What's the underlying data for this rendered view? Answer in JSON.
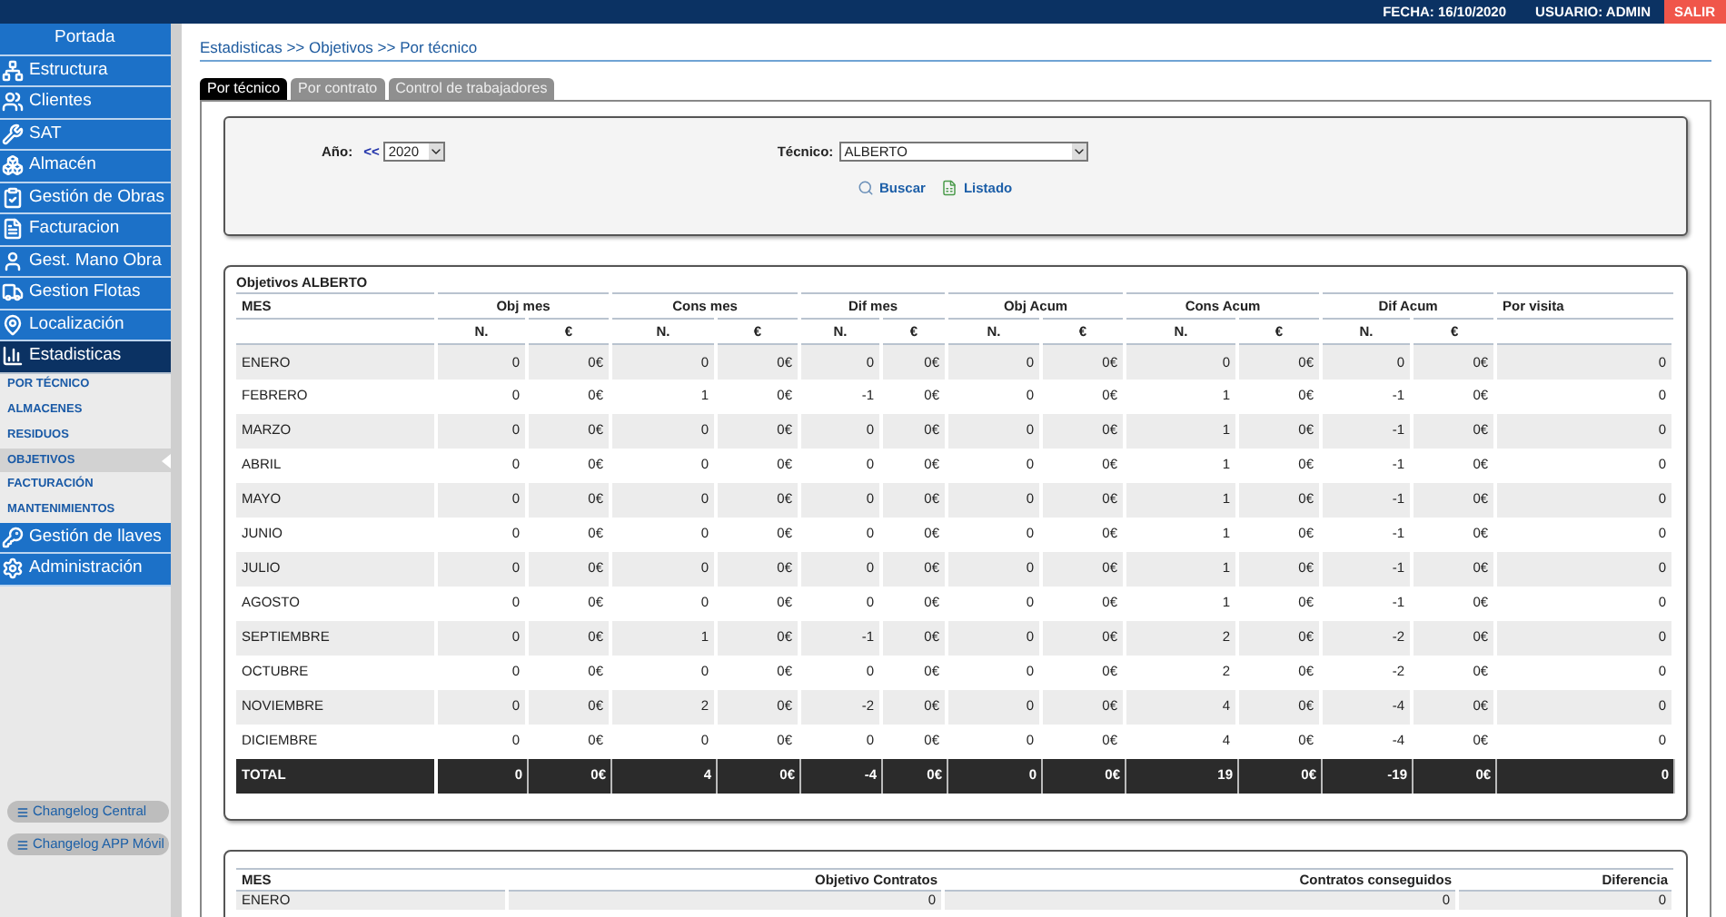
{
  "header": {
    "date": "FECHA: 16/10/2020",
    "user": "USUARIO: ADMIN",
    "logout": "SALIR"
  },
  "sidebar": {
    "items": [
      {
        "label": "Portada",
        "selected": false
      },
      {
        "label": "Estructura",
        "selected": false
      },
      {
        "label": "Clientes",
        "selected": false
      },
      {
        "label": "SAT",
        "selected": false
      },
      {
        "label": "Almacén",
        "selected": false
      },
      {
        "label": "Gestión de Obras",
        "selected": false
      },
      {
        "label": "Facturacion",
        "selected": false
      },
      {
        "label": "Gest. Mano Obra",
        "selected": false
      },
      {
        "label": "Gestion Flotas",
        "selected": false
      },
      {
        "label": "Localización",
        "selected": false
      },
      {
        "label": "Estadisticas",
        "selected": true,
        "children": [
          {
            "label": "POR TÉCNICO",
            "selected": false
          },
          {
            "label": "ALMACENES",
            "selected": false
          },
          {
            "label": "RESIDUOS",
            "selected": false
          },
          {
            "label": "OBJETIVOS",
            "selected": true
          },
          {
            "label": "FACTURACIÓN",
            "selected": false
          },
          {
            "label": "MANTENIMIENTOS",
            "selected": false
          }
        ]
      },
      {
        "label": "Gestión de llaves",
        "selected": false
      },
      {
        "label": "Administración",
        "selected": false
      }
    ],
    "changelog_buttons": [
      "Changelog Central",
      "Changelog APP Móvil"
    ]
  },
  "breadcrumb": "Estadisticas >> Objetivos >> Por técnico",
  "tabs": [
    {
      "label": "Por técnico",
      "selected": true
    },
    {
      "label": "Por contrato",
      "selected": false
    },
    {
      "label": "Control de trabajadores",
      "selected": false
    }
  ],
  "filters": {
    "year_label": "Año:",
    "prev": "<<",
    "year": "2020",
    "tech_label": "Técnico:",
    "tech": "ALBERTO",
    "actions": [
      {
        "label": "Buscar",
        "kind": "search"
      },
      {
        "label": "Listado",
        "kind": "list"
      }
    ]
  },
  "objectives_table": {
    "title": "Objetivos ALBERTO",
    "first_column": "MES",
    "groups": [
      {
        "label": "Obj mes",
        "sub": [
          "N.",
          "€"
        ]
      },
      {
        "label": "Cons mes",
        "sub": [
          "N.",
          "€"
        ]
      },
      {
        "label": "Dif mes",
        "sub": [
          "N.",
          "€"
        ]
      },
      {
        "label": "Obj Acum",
        "sub": [
          "N.",
          "€"
        ]
      },
      {
        "label": "Cons Acum",
        "sub": [
          "N.",
          "€"
        ]
      },
      {
        "label": "Dif Acum",
        "sub": [
          "N.",
          "€"
        ]
      },
      {
        "label": "Por visita"
      }
    ],
    "rows": [
      {
        "month": "ENERO",
        "values": [
          "0",
          "0€",
          "0",
          "0€",
          "0",
          "0€",
          "0",
          "0€",
          "0",
          "0€",
          "0",
          "0€",
          "0"
        ]
      },
      {
        "month": "FEBRERO",
        "values": [
          "0",
          "0€",
          "1",
          "0€",
          "-1",
          "0€",
          "0",
          "0€",
          "1",
          "0€",
          "-1",
          "0€",
          "0"
        ]
      },
      {
        "month": "MARZO",
        "values": [
          "0",
          "0€",
          "0",
          "0€",
          "0",
          "0€",
          "0",
          "0€",
          "1",
          "0€",
          "-1",
          "0€",
          "0"
        ]
      },
      {
        "month": "ABRIL",
        "values": [
          "0",
          "0€",
          "0",
          "0€",
          "0",
          "0€",
          "0",
          "0€",
          "1",
          "0€",
          "-1",
          "0€",
          "0"
        ]
      },
      {
        "month": "MAYO",
        "values": [
          "0",
          "0€",
          "0",
          "0€",
          "0",
          "0€",
          "0",
          "0€",
          "1",
          "0€",
          "-1",
          "0€",
          "0"
        ]
      },
      {
        "month": "JUNIO",
        "values": [
          "0",
          "0€",
          "0",
          "0€",
          "0",
          "0€",
          "0",
          "0€",
          "1",
          "0€",
          "-1",
          "0€",
          "0"
        ]
      },
      {
        "month": "JULIO",
        "values": [
          "0",
          "0€",
          "0",
          "0€",
          "0",
          "0€",
          "0",
          "0€",
          "1",
          "0€",
          "-1",
          "0€",
          "0"
        ]
      },
      {
        "month": "AGOSTO",
        "values": [
          "0",
          "0€",
          "0",
          "0€",
          "0",
          "0€",
          "0",
          "0€",
          "1",
          "0€",
          "-1",
          "0€",
          "0"
        ]
      },
      {
        "month": "SEPTIEMBRE",
        "values": [
          "0",
          "0€",
          "1",
          "0€",
          "-1",
          "0€",
          "0",
          "0€",
          "2",
          "0€",
          "-2",
          "0€",
          "0"
        ]
      },
      {
        "month": "OCTUBRE",
        "values": [
          "0",
          "0€",
          "0",
          "0€",
          "0",
          "0€",
          "0",
          "0€",
          "2",
          "0€",
          "-2",
          "0€",
          "0"
        ]
      },
      {
        "month": "NOVIEMBRE",
        "values": [
          "0",
          "0€",
          "2",
          "0€",
          "-2",
          "0€",
          "0",
          "0€",
          "4",
          "0€",
          "-4",
          "0€",
          "0"
        ]
      },
      {
        "month": "DICIEMBRE",
        "values": [
          "0",
          "0€",
          "0",
          "0€",
          "0",
          "0€",
          "0",
          "0€",
          "4",
          "0€",
          "-4",
          "0€",
          "0"
        ]
      }
    ],
    "total": {
      "month": "TOTAL",
      "values": [
        "0",
        "0€",
        "4",
        "0€",
        "-4",
        "0€",
        "0",
        "0€",
        "19",
        "0€",
        "-19",
        "0€",
        "0"
      ]
    }
  },
  "contracts_table": {
    "columns": [
      "MES",
      "Objetivo Contratos",
      "Contratos conseguidos",
      "Diferencia"
    ],
    "rows": [
      {
        "month": "ENERO",
        "values": [
          "0",
          "0",
          "0"
        ]
      }
    ]
  }
}
